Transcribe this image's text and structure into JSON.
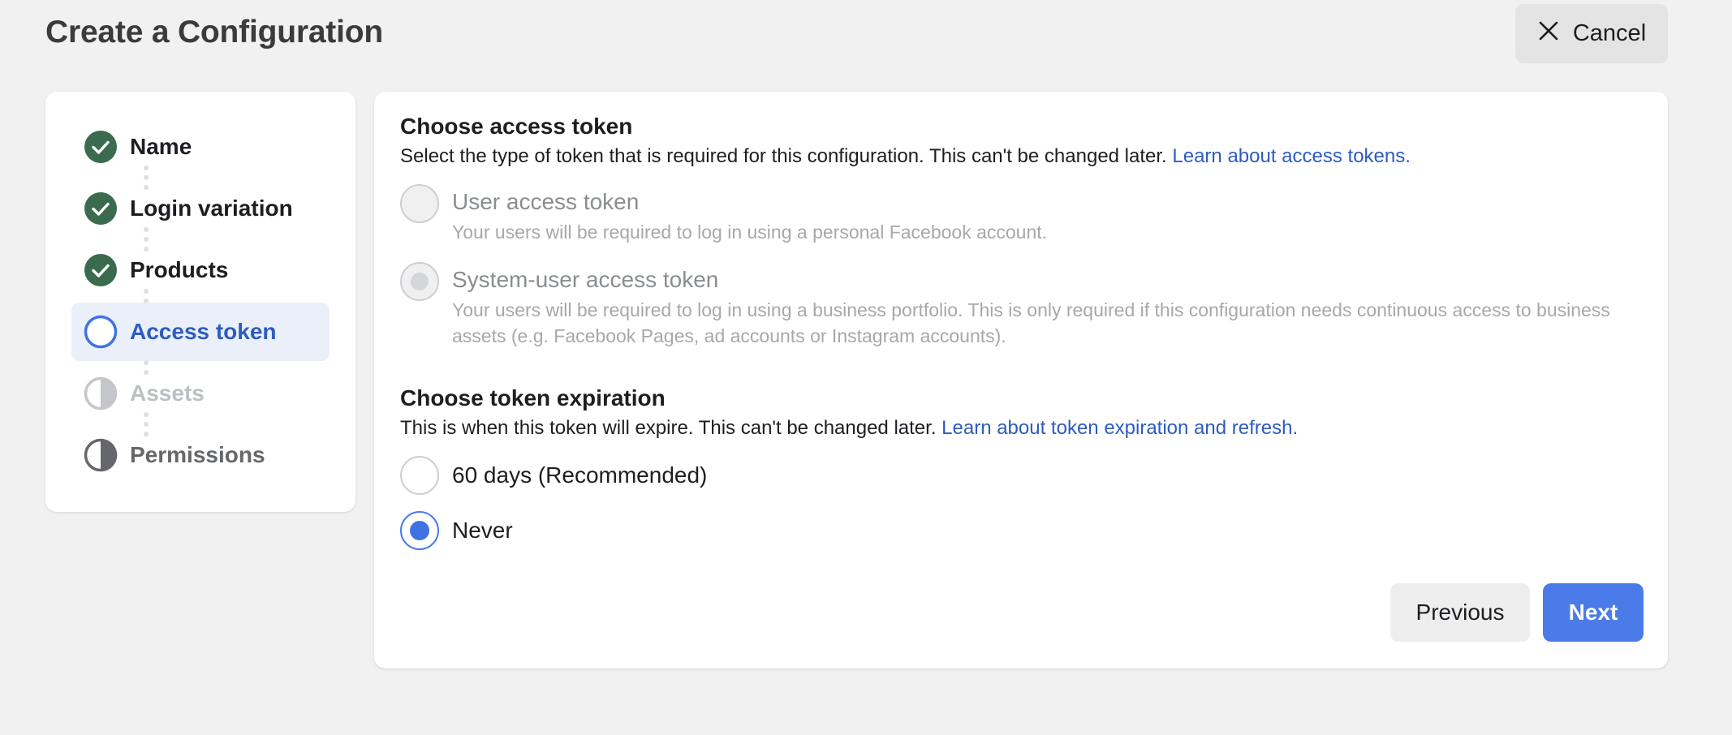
{
  "page": {
    "title": "Create a Configuration",
    "cancel_label": "Cancel"
  },
  "steps": [
    {
      "label": "Name",
      "state": "complete"
    },
    {
      "label": "Login variation",
      "state": "complete"
    },
    {
      "label": "Products",
      "state": "complete"
    },
    {
      "label": "Access token",
      "state": "current"
    },
    {
      "label": "Assets",
      "state": "incomplete-disabled"
    },
    {
      "label": "Permissions",
      "state": "incomplete"
    }
  ],
  "access_token": {
    "title": "Choose access token",
    "description": "Select the type of token that is required for this configuration. This can't be changed later.",
    "link": "Learn about access tokens.",
    "options": [
      {
        "label": "User access token",
        "sub": "Your users will be required to log in using a personal Facebook account.",
        "selected": false,
        "disabled": true
      },
      {
        "label": "System-user access token",
        "sub": "Your users will be required to log in using a business portfolio. This is only required if this configuration needs continuous access to business assets (e.g. Facebook Pages, ad accounts or Instagram accounts).",
        "selected": true,
        "disabled": true
      }
    ]
  },
  "expiration": {
    "title": "Choose token expiration",
    "description": "This is when this token will expire. This can't be changed later.",
    "link": "Learn about token expiration and refresh.",
    "options": [
      {
        "label": "60 days (Recommended)",
        "selected": false
      },
      {
        "label": "Never",
        "selected": true
      }
    ]
  },
  "footer": {
    "previous_label": "Previous",
    "next_label": "Next"
  },
  "colors": {
    "accent": "#4a7be8",
    "complete": "#3a6b4f",
    "active_bg": "#eaeff9",
    "page_bg": "#f1f1f1"
  }
}
